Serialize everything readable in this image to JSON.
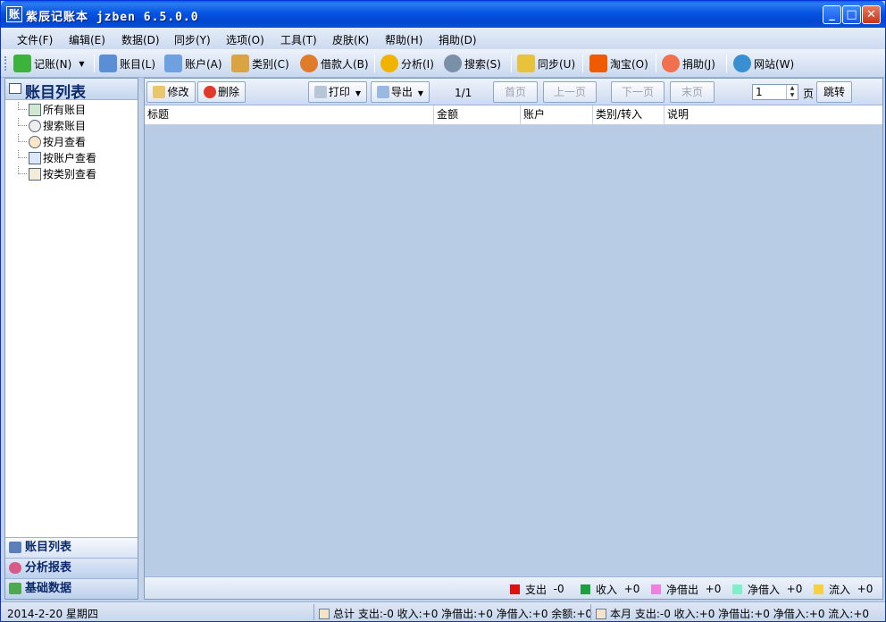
{
  "window": {
    "title": "紫辰记账本  jzben  6.5.0.0",
    "icon_char": "账",
    "minimize_icon": "minimize-icon",
    "maximize_icon": "maximize-icon",
    "close_icon": "close-icon"
  },
  "menu": [
    {
      "label": "文件(F)"
    },
    {
      "label": "编辑(E)"
    },
    {
      "label": "数据(D)"
    },
    {
      "label": "同步(Y)"
    },
    {
      "label": "选项(O)"
    },
    {
      "label": "工具(T)"
    },
    {
      "label": "皮肤(K)"
    },
    {
      "label": "帮助(H)"
    },
    {
      "label": "捐助(D)"
    }
  ],
  "toolbar": [
    {
      "label": "记账(N)",
      "icon": "plus-icon",
      "color": "#3cb43c"
    },
    {
      "label": "账目(L)",
      "icon": "ledger-icon",
      "color": "#5a8fd8"
    },
    {
      "label": "账户(A)",
      "icon": "account-icon",
      "color": "#6fa0e0"
    },
    {
      "label": "类别(C)",
      "icon": "category-icon",
      "color": "#d9a441"
    },
    {
      "label": "借款人(B)",
      "icon": "person-icon",
      "color": "#e07b2c"
    },
    {
      "label": "分析(I)",
      "icon": "pie-chart-icon",
      "color": "#f0b400"
    },
    {
      "label": "搜索(S)",
      "icon": "magnifier-icon",
      "color": "#7a8fa8"
    },
    {
      "label": "同步(U)",
      "icon": "sync-icon",
      "color": "#e8c23a"
    },
    {
      "label": "淘宝(O)",
      "icon": "taobao-icon",
      "color": "#f05a00"
    },
    {
      "label": "捐助(J)",
      "icon": "heart-icon",
      "color": "#f07050"
    },
    {
      "label": "网站(W)",
      "icon": "globe-icon",
      "color": "#3a8fd0"
    }
  ],
  "left_panel": {
    "title": "账目列表",
    "tree": [
      {
        "label": "所有账目",
        "icon": "all-entries-icon"
      },
      {
        "label": "搜索账目",
        "icon": "search-icon"
      },
      {
        "label": "按月查看",
        "icon": "clock-icon"
      },
      {
        "label": "按账户查看",
        "icon": "account-view-icon"
      },
      {
        "label": "按类别查看",
        "icon": "category-view-icon"
      }
    ],
    "nav_tabs": [
      {
        "label": "账目列表",
        "icon": "list-icon",
        "color": "#5b7fb8"
      },
      {
        "label": "分析报表",
        "icon": "report-icon",
        "color": "#d85a8a"
      },
      {
        "label": "基础数据",
        "icon": "puzzle-icon",
        "color": "#4fa84f"
      }
    ]
  },
  "list_toolbar": {
    "edit": "修改",
    "delete": "删除",
    "print": "打印",
    "export": "导出",
    "page_info": "1/1",
    "first": "首页",
    "prev": "上一页",
    "next": "下一页",
    "last": "末页",
    "page_value": "1",
    "page_unit": "页",
    "jump": "跳转"
  },
  "table": {
    "columns": [
      "标题",
      "金额",
      "账户",
      "类别/转入",
      "说明"
    ],
    "rows": []
  },
  "legend": [
    {
      "label": "支出",
      "value": "-0",
      "color": "#e01010"
    },
    {
      "label": "收入",
      "value": "+0",
      "color": "#1fa040"
    },
    {
      "label": "净借出",
      "value": "+0",
      "color": "#f080e0"
    },
    {
      "label": "净借入",
      "value": "+0",
      "color": "#80f0c8"
    },
    {
      "label": "流入",
      "value": "+0",
      "color": "#f8d040"
    }
  ],
  "status": {
    "date": "2014-2-20 星期四",
    "total": "总计 支出:-0 收入:+0 净借出:+0 净借入:+0 余额:+0",
    "month": "本月 支出:-0 收入:+0 净借出:+0 净借入:+0 流入:+0"
  }
}
